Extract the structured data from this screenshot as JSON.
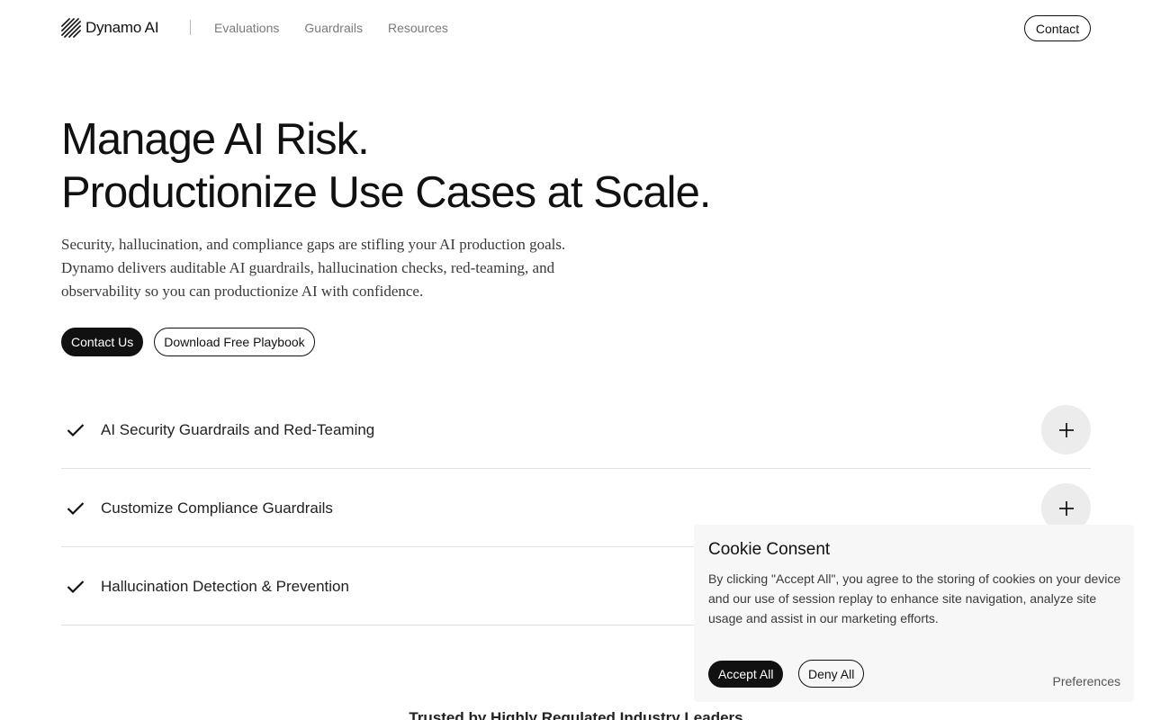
{
  "header": {
    "logo_text": "Dynamo AI",
    "nav": [
      "Evaluations",
      "Guardrails",
      "Resources"
    ],
    "contact_label": "Contact"
  },
  "hero": {
    "title_line1": "Manage AI Risk.",
    "title_line2": "Productionize Use Cases at Scale.",
    "subtitle": "Security, hallucination, and compliance gaps are stifling your AI production goals. Dynamo delivers auditable AI guardrails, hallucination checks, red-teaming, and observability so you can productionize AI with confidence.",
    "cta_primary": "Contact Us",
    "cta_secondary": "Download Free Playbook"
  },
  "features": [
    {
      "label": "AI Security Guardrails and Red-Teaming",
      "icon": "check-icon",
      "toggle_icon": "plus-icon"
    },
    {
      "label": "Customize Compliance Guardrails",
      "icon": "check-icon",
      "toggle_icon": "plus-icon"
    },
    {
      "label": "Hallucination Detection & Prevention",
      "icon": "check-icon",
      "toggle_icon": "plus-icon"
    }
  ],
  "trusted_heading": "Trusted by Highly Regulated Industry Leaders",
  "cookie": {
    "title": "Cookie Consent",
    "text": "By clicking \"Accept All\", you agree to the storing of cookies on your device and our use of session replay to enhance site navigation, analyze site usage and assist in our marketing efforts.",
    "accept_label": "Accept All",
    "deny_label": "Deny All",
    "preferences_label": "Preferences"
  },
  "colors": {
    "accent": "#111111",
    "muted_nav": "#7a7a7a",
    "toggle_bg": "#ececec",
    "cookie_bg": "#f7f7f7"
  }
}
